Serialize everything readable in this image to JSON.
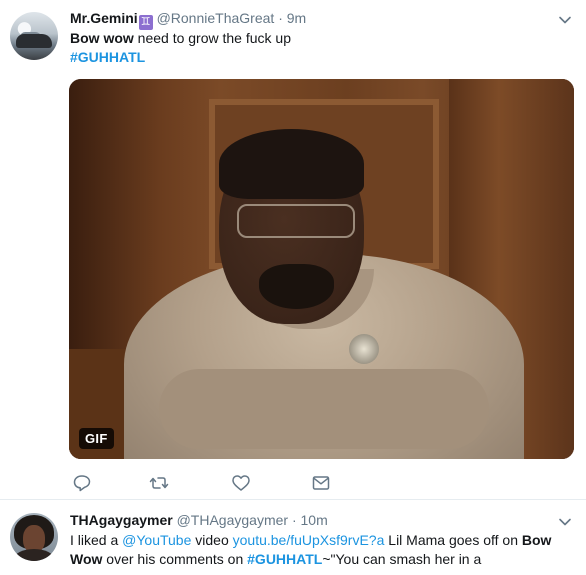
{
  "tweets": [
    {
      "display_name": "Mr.Gemini",
      "name_emoji": "♊",
      "handle": "@RonnieThaGreat",
      "separator": "·",
      "time": "9m",
      "text_bold": "Bow wow",
      "text_rest": " need to grow the fuck up",
      "hashtag": "#GUHHATL",
      "media_badge": "GIF"
    },
    {
      "display_name": "THAgaygaymer",
      "handle": "@THAgaygaymer",
      "separator": "·",
      "time": "10m",
      "t1": "I liked a ",
      "mention": "@YouTube",
      "t2": " video ",
      "url": "youtu.be/fuUpXsf9rvE?a",
      "t3": " Lil Mama goes off on ",
      "bold1": "Bow",
      "bold2": "Wow",
      "t4": " over his comments on ",
      "hashtag": "#GUHHATL",
      "t5": "~\"You can smash her in a"
    }
  ],
  "icons": {
    "avatar1": "avatar-car",
    "avatar2": "avatar-person",
    "caret": "chevron-down-icon",
    "reply": "reply-icon",
    "retweet": "retweet-icon",
    "like": "heart-icon",
    "message": "envelope-icon"
  },
  "colors": {
    "link": "#1c94e0",
    "muted": "#657786",
    "text": "#14171a",
    "divider": "#e6ecf0"
  }
}
